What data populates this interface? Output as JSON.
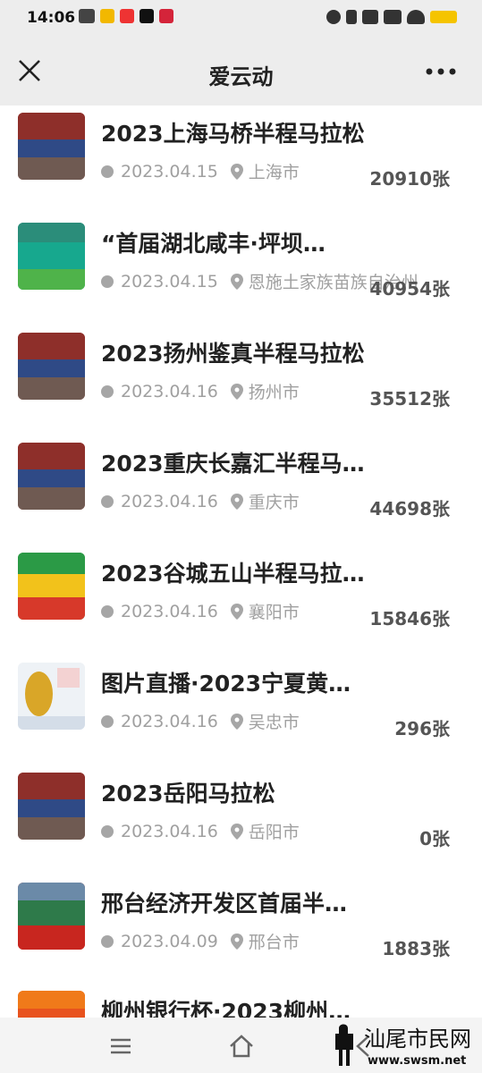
{
  "status": {
    "time": "14:06"
  },
  "header": {
    "title": "爱云动"
  },
  "items": [
    {
      "title": "2023上海马桥半程马拉松",
      "date": "2023.04.15",
      "location": "上海市",
      "count": "20910张"
    },
    {
      "title": "“首届湖北咸丰·坪坝…",
      "date": "2023.04.15",
      "location": "恩施土家族苗族自治州",
      "count": "40954张"
    },
    {
      "title": "2023扬州鉴真半程马拉松",
      "date": "2023.04.16",
      "location": "扬州市",
      "count": "35512张"
    },
    {
      "title": "2023重庆长嘉汇半程马…",
      "date": "2023.04.16",
      "location": "重庆市",
      "count": "44698张"
    },
    {
      "title": "2023谷城五山半程马拉…",
      "date": "2023.04.16",
      "location": "襄阳市",
      "count": "15846张"
    },
    {
      "title": "图片直播·2023宁夏黄…",
      "date": "2023.04.16",
      "location": "吴忠市",
      "count": "296张"
    },
    {
      "title": "2023岳阳马拉松",
      "date": "2023.04.16",
      "location": "岳阳市",
      "count": "0张"
    },
    {
      "title": "邢台经济开发区首届半…",
      "date": "2023.04.09",
      "location": "邢台市",
      "count": "1883张"
    },
    {
      "title": "柳州银行杯·2023柳州…",
      "date": "",
      "location": "",
      "count": ""
    }
  ],
  "watermark": {
    "text": "汕尾市民网",
    "url": "www.swsm.net"
  },
  "colors": {
    "statusbar_bg": "#ededed",
    "text_primary": "#222222",
    "text_secondary": "#a0a0a0",
    "count_text": "#555555"
  }
}
